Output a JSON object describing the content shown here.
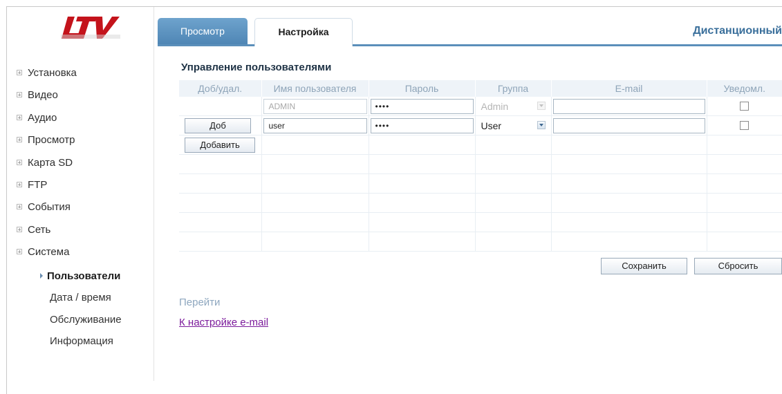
{
  "logo": {
    "text": "LTV",
    "color": "#c4131b"
  },
  "sidebar": {
    "items": [
      {
        "label": "Установка"
      },
      {
        "label": "Видео"
      },
      {
        "label": "Аудио"
      },
      {
        "label": "Просмотр"
      },
      {
        "label": "Карта SD"
      },
      {
        "label": "FTP"
      },
      {
        "label": "События"
      },
      {
        "label": "Сеть"
      },
      {
        "label": "Система"
      }
    ],
    "subitems": [
      {
        "label": "Пользователи",
        "active": true
      },
      {
        "label": "Дата / время"
      },
      {
        "label": "Обслуживание"
      },
      {
        "label": "Информация"
      }
    ]
  },
  "tabs": [
    {
      "label": "Просмотр"
    },
    {
      "label": "Настройка",
      "active": true
    }
  ],
  "header": {
    "remote_title": "Дистанционный"
  },
  "section": {
    "title": "Управление пользователями"
  },
  "table": {
    "columns": [
      "Доб/удал.",
      "Имя пользователя",
      "Пароль",
      "Группа",
      "E-mail",
      "Уведомл."
    ],
    "rows": [
      {
        "username": "ADMIN",
        "password": "••••",
        "group": "Admin",
        "email": "",
        "notify": false,
        "disabled": true
      },
      {
        "username": "user",
        "password": "••••",
        "group": "User",
        "email": "",
        "notify": false,
        "disabled": false,
        "button": "Доб"
      }
    ],
    "add_button": "Добавить"
  },
  "actions": {
    "save": "Сохранить",
    "reset": "Сбросить"
  },
  "goto": {
    "label": "Перейти",
    "link": "К настройке e-mail"
  },
  "colors": {
    "accent": "#5b8fba",
    "header_text": "#8ea4b8",
    "link": "#7b1a9b"
  }
}
